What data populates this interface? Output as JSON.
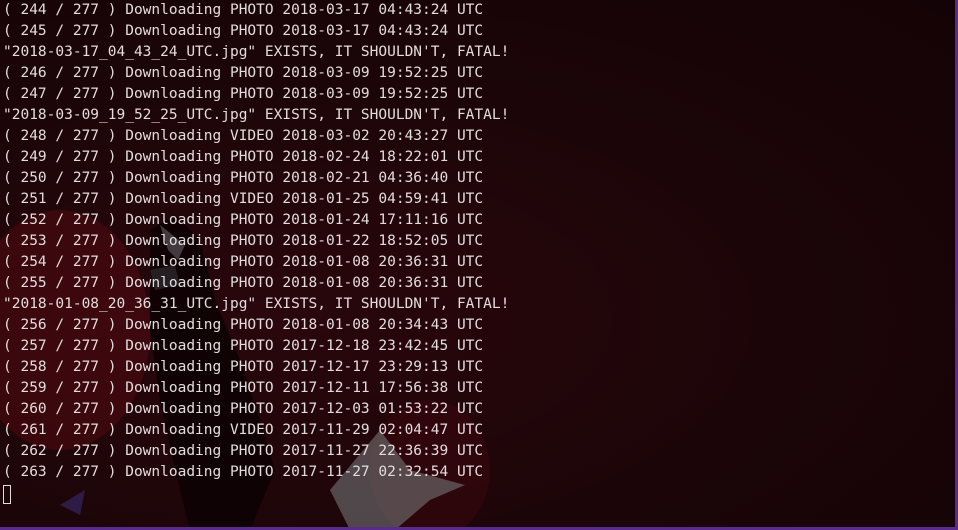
{
  "terminal": {
    "lines": [
      "( 244 / 277 ) Downloading PHOTO 2018-03-17 04:43:24 UTC",
      "( 245 / 277 ) Downloading PHOTO 2018-03-17 04:43:24 UTC",
      "\"2018-03-17_04_43_24_UTC.jpg\" EXISTS, IT SHOULDN'T, FATAL!",
      "( 246 / 277 ) Downloading PHOTO 2018-03-09 19:52:25 UTC",
      "( 247 / 277 ) Downloading PHOTO 2018-03-09 19:52:25 UTC",
      "\"2018-03-09_19_52_25_UTC.jpg\" EXISTS, IT SHOULDN'T, FATAL!",
      "( 248 / 277 ) Downloading VIDEO 2018-03-02 20:43:27 UTC",
      "( 249 / 277 ) Downloading PHOTO 2018-02-24 18:22:01 UTC",
      "( 250 / 277 ) Downloading PHOTO 2018-02-21 04:36:40 UTC",
      "( 251 / 277 ) Downloading VIDEO 2018-01-25 04:59:41 UTC",
      "( 252 / 277 ) Downloading PHOTO 2018-01-24 17:11:16 UTC",
      "( 253 / 277 ) Downloading PHOTO 2018-01-22 18:52:05 UTC",
      "( 254 / 277 ) Downloading PHOTO 2018-01-08 20:36:31 UTC",
      "( 255 / 277 ) Downloading PHOTO 2018-01-08 20:36:31 UTC",
      "\"2018-01-08_20_36_31_UTC.jpg\" EXISTS, IT SHOULDN'T, FATAL!",
      "( 256 / 277 ) Downloading PHOTO 2018-01-08 20:34:43 UTC",
      "( 257 / 277 ) Downloading PHOTO 2017-12-18 23:42:45 UTC",
      "( 258 / 277 ) Downloading PHOTO 2017-12-17 23:29:13 UTC",
      "( 259 / 277 ) Downloading PHOTO 2017-12-11 17:56:38 UTC",
      "( 260 / 277 ) Downloading PHOTO 2017-12-03 01:53:22 UTC",
      "( 261 / 277 ) Downloading VIDEO 2017-11-29 02:04:47 UTC",
      "( 262 / 277 ) Downloading PHOTO 2017-11-27 22:36:39 UTC",
      "( 263 / 277 ) Downloading PHOTO 2017-11-27 02:32:54 UTC"
    ]
  },
  "colors": {
    "background": "#1b0508",
    "text": "#e2dcdd",
    "border": "#5b2a8f"
  }
}
